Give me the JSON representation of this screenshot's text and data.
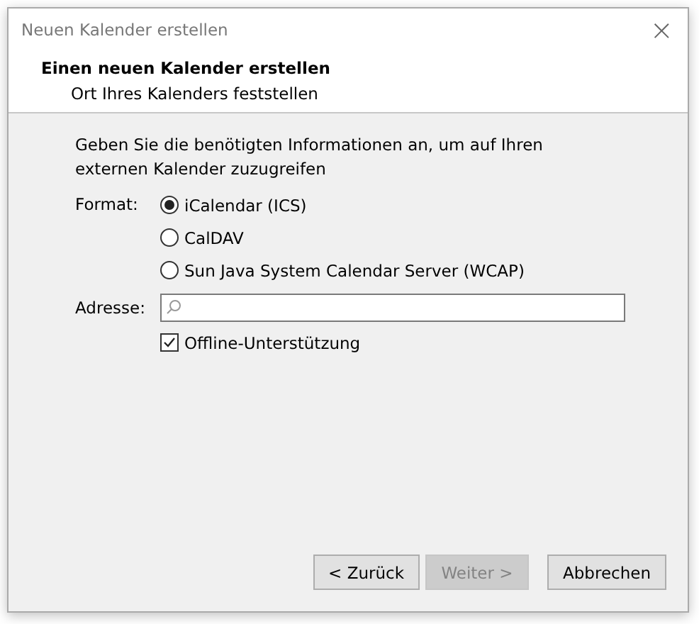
{
  "window": {
    "title": "Neuen Kalender erstellen",
    "close": "×"
  },
  "header": {
    "title": "Einen neuen Kalender erstellen",
    "subtitle": "Ort Ihres Kalenders feststellen"
  },
  "intro": "Geben Sie die benötigten Informationen an, um auf Ihren externen Kalender zuzugreifen",
  "format": {
    "label": "Format:",
    "options": [
      {
        "label": "iCalendar (ICS)",
        "selected": true
      },
      {
        "label": "CalDAV",
        "selected": false
      },
      {
        "label": "Sun Java System Calendar Server (WCAP)",
        "selected": false
      }
    ]
  },
  "address": {
    "label": "Adresse:"
  },
  "offline": {
    "label": "Offline-Unterstützung",
    "checked": true
  },
  "buttons": [
    {
      "label": "< Zurück",
      "disabled": false
    },
    {
      "label": "Weiter >",
      "disabled": true
    },
    {
      "label": "Abbrechen",
      "disabled": false
    }
  ]
}
